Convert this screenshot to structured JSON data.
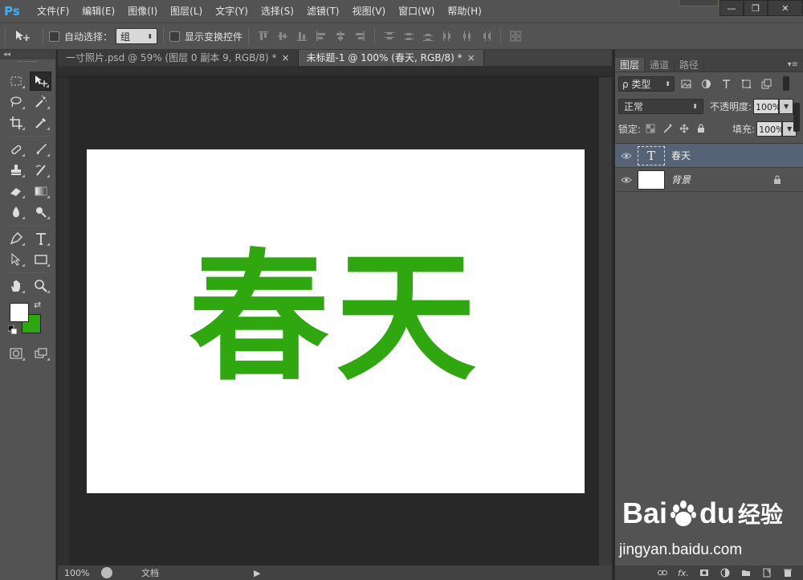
{
  "app": {
    "logo": "Ps"
  },
  "menu": [
    "文件(F)",
    "编辑(E)",
    "图像(I)",
    "图层(L)",
    "文字(Y)",
    "选择(S)",
    "滤镜(T)",
    "视图(V)",
    "窗口(W)",
    "帮助(H)"
  ],
  "window_controls": {
    "minimize": "—",
    "restore": "❐",
    "close": "✕"
  },
  "options_bar": {
    "auto_select_label": "自动选择：",
    "auto_select_value": "组",
    "show_transform_label": "显示变换控件"
  },
  "tabs": [
    {
      "label": "一寸照片.psd @ 59% (图层 0 副本 9, RGB/8) *",
      "active": false
    },
    {
      "label": "未标题-1 @ 100% (春天, RGB/8) *",
      "active": true
    }
  ],
  "tab_close_glyph": "×",
  "canvas": {
    "text": "春天",
    "text_color": "#2ea80e"
  },
  "status": {
    "zoom": "100%",
    "doc_label": "文档",
    "arrow": "▶"
  },
  "layers_panel": {
    "tabs": [
      "图层",
      "通道",
      "路径"
    ],
    "filter_label": "ρ 类型",
    "blend_mode": "正常",
    "opacity_label": "不透明度:",
    "opacity_value": "100%",
    "lock_label": "锁定:",
    "fill_label": "填充:",
    "fill_value": "100%",
    "layers": [
      {
        "name": "春天",
        "type": "text",
        "thumb_glyph": "T",
        "selected": true,
        "locked": false
      },
      {
        "name": "背景",
        "type": "background",
        "thumb_glyph": "",
        "selected": false,
        "locked": true
      }
    ],
    "footer_fx": "fx."
  },
  "colors": {
    "foreground": "#ffffff",
    "background": "#2ea80e"
  },
  "watermark": {
    "brand": "Bai",
    "brand_du": "du",
    "brand_suffix": "经验",
    "url": "jingyan.baidu.com"
  }
}
